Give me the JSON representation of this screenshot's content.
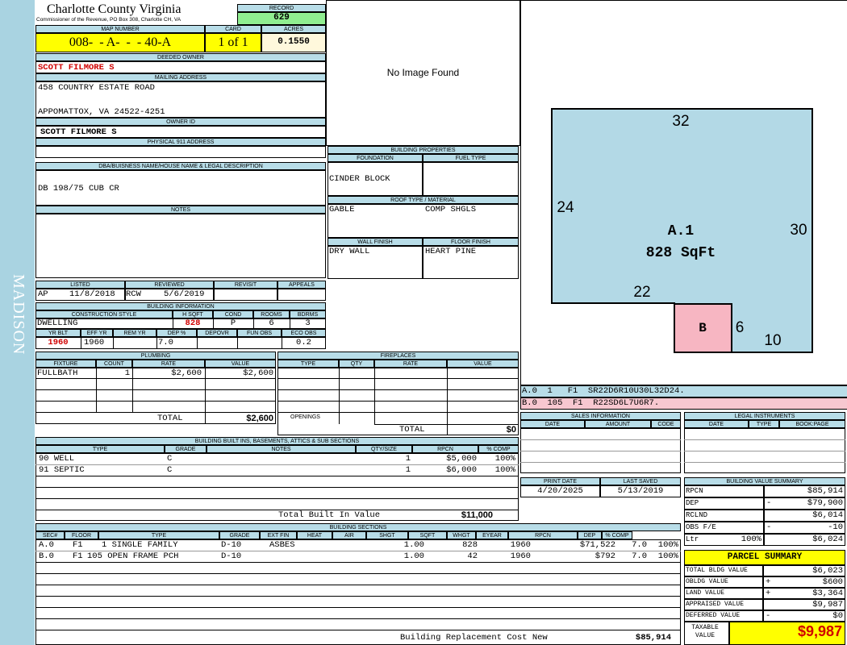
{
  "sidebar": {
    "label": "MADISON"
  },
  "header": {
    "county": "Charlotte County Virginia",
    "office": "Commissioner of the Revenue, PO Box 308, Charlotte CH, VA",
    "record_label": "RECORD",
    "record": "629",
    "map_label": "MAP NUMBER",
    "map_number": "008-  - A-  -  - 40-A",
    "card_label": "CARD",
    "card": "1 of 1",
    "acres_label": "ACRES",
    "acres": "0.1550"
  },
  "owner": {
    "deeded_label": "DEEDED OWNER",
    "deeded": "SCOTT FILMORE S",
    "mailing_label": "MAILING ADDRESS",
    "addr1": "458 COUNTRY ESTATE ROAD",
    "addr2": "APPOMATTOX, VA 24522-4251",
    "id_label": "OWNER ID",
    "id_value": "SCOTT FILMORE S",
    "phys_label": "PHYSICAL 911 ADDRESS",
    "phys_value": ""
  },
  "legal": {
    "label": "DBA/BUISNESS NAME/HOUSE NAME & LEGAL DESCRIPTION",
    "value": "DB 198/75 CUB CR"
  },
  "notes": {
    "label": "NOTES"
  },
  "image": {
    "text": "No Image Found"
  },
  "building_props": {
    "title": "BUILDING PROPERTIES",
    "foundation_label": "FOUNDATION",
    "foundation": "CINDER BLOCK",
    "fuel_label": "FUEL TYPE",
    "fuel": "",
    "roof_label": "ROOF TYPE / MATERIAL",
    "roof_type": "GABLE",
    "roof_mat": "COMP SHGLS",
    "wall_label": "WALL FINISH",
    "wall": "DRY WALL",
    "floor_label": "FLOOR FINISH",
    "floor": "HEART PINE"
  },
  "review": {
    "listed_label": "LISTED",
    "listed_by": "AP",
    "listed_date": "11/8/2018",
    "reviewed_label": "REVIEWED",
    "reviewed_by": "RCW",
    "reviewed_date": "5/6/2019",
    "revisit_label": "REVISIT",
    "appeals_label": "APPEALS"
  },
  "building_info": {
    "title": "BUILDING INFORMATION",
    "style_label": "CONSTRUCTION STYLE",
    "style": "DWELLING",
    "hsqft_label": "H SQFT",
    "hsqft": "828",
    "cond_label": "COND",
    "cond": "P",
    "rooms_label": "ROOMS",
    "rooms": "6",
    "bdrms_label": "BDRMS",
    "bdrms": "3",
    "yrblt_label": "YR BLT",
    "yrblt": "1960",
    "effyr_label": "EFF YR",
    "effyr": "1960",
    "remyr_label": "REM YR",
    "remyr": "",
    "dep_label": "DEP %",
    "dep": "7.0",
    "depovr_label": "DEPOVR",
    "depovr": "",
    "funobs_label": "FUN OBS",
    "funobs": "",
    "ecoobs_label": "ECO OBS",
    "ecoobs": "0.2"
  },
  "plumbing": {
    "title": "PLUMBING",
    "h_fixture": "FIXTURE",
    "h_count": "COUNT",
    "h_rate": "RATE",
    "h_value": "VALUE",
    "rows": [
      {
        "fixture": "FULLBATH",
        "count": "1",
        "rate": "$2,600",
        "value": "$2,600"
      }
    ],
    "total_label": "TOTAL",
    "total": "$2,600"
  },
  "fireplaces": {
    "title": "FIREPLACES",
    "h_type": "TYPE",
    "h_qty": "QTY",
    "h_rate": "RATE",
    "h_value": "VALUE",
    "openings_label": "OPENINGS",
    "total_label": "TOTAL",
    "total": "$0"
  },
  "builtins": {
    "title": "BUILDING BUILT INS, BASEMENTS, ATTICS & SUB SECTIONS",
    "h_type": "TYPE",
    "h_grade": "GRADE",
    "h_notes": "NOTES",
    "h_qty": "QTY/SIZE",
    "h_rpcn": "RPCN",
    "h_comp": "% COMP",
    "rows": [
      {
        "type": "90 WELL",
        "grade": "C",
        "qty": "1",
        "rpcn": "$5,000",
        "comp": "100%"
      },
      {
        "type": "91 SEPTIC",
        "grade": "C",
        "qty": "1",
        "rpcn": "$6,000",
        "comp": "100%"
      }
    ],
    "total_label": "Total Built In Value",
    "total": "$11,000"
  },
  "sections": {
    "title": "BUILDING SECTIONS",
    "headers": [
      "SEC#",
      "FLOOR",
      "TYPE",
      "GRADE",
      "EXT FIN",
      "HEAT",
      "AIR",
      "SHGT",
      "SQFT",
      "WHGT",
      "EYEAR",
      "RPCN",
      "DEP",
      "% COMP"
    ],
    "rows": [
      {
        "sec": "A.0",
        "floor": "F1",
        "type": "1 SINGLE FAMILY",
        "grade": "D-10",
        "ext": "ASBES",
        "shgt": "1.00",
        "sqft": "828",
        "eyear": "1960",
        "rpcn": "$71,522",
        "dep": "7.0",
        "comp": "100%"
      },
      {
        "sec": "B.0",
        "floor": "F1",
        "type": "105 OPEN FRAME PCH",
        "grade": "D-10",
        "ext": "",
        "shgt": "1.00",
        "sqft": "42",
        "eyear": "1960",
        "rpcn": "$792",
        "dep": "7.0",
        "comp": "100%"
      }
    ],
    "brcn_label": "Building Replacement Cost New",
    "brcn": "$85,914"
  },
  "sketch": {
    "a_label": "A.1",
    "a_area": "828 SqFt",
    "b_label": "B",
    "dims": [
      "32",
      "24",
      "30",
      "22",
      "6",
      "10"
    ],
    "colors": {
      "a": "#b3d9e6",
      "b": "#f7b6c2"
    }
  },
  "sketch_codes": [
    {
      "code": "A.0  1   F1  SR22D6R10U30L32D24."
    },
    {
      "code": "B.0  105  F1  R22SD6L7U6R7."
    }
  ],
  "sales": {
    "title": "SALES INFORMATION",
    "h_date": "DATE",
    "h_amount": "AMOUNT",
    "h_code": "CODE"
  },
  "legal_inst": {
    "title": "LEGAL INSTRUMENTS",
    "h_date": "DATE",
    "h_type": "TYPE",
    "h_book": "BOOK:PAGE"
  },
  "dates": {
    "print_label": "PRINT DATE",
    "print_date": "4/20/2025",
    "saved_label": "LAST SAVED",
    "saved_date": "5/13/2019"
  },
  "bvs": {
    "title": "BUILDING VALUE SUMMARY",
    "rows": [
      {
        "label": "RPCN",
        "sign": "",
        "pct": "",
        "value": "$85,914"
      },
      {
        "label": "DEP",
        "sign": "-",
        "pct": "",
        "value": "$79,900"
      },
      {
        "label": "RCLND",
        "sign": "",
        "pct": "",
        "value": "$6,014"
      },
      {
        "label": "OBS F/E",
        "sign": "-",
        "pct": "",
        "value": "-10"
      },
      {
        "label": "Ltr",
        "sign": "",
        "pct": "100%",
        "value": "$6,024"
      }
    ]
  },
  "parcel": {
    "title": "PARCEL SUMMARY",
    "rows": [
      {
        "label": "TOTAL BLDG VALUE",
        "sign": "",
        "value": "$6,023"
      },
      {
        "label": "OBLDG VALUE",
        "sign": "+",
        "value": "$600"
      },
      {
        "label": "LAND VALUE",
        "sign": "+",
        "value": "$3,364"
      },
      {
        "label": "APPRAISED VALUE",
        "sign": "",
        "value": "$9,987"
      },
      {
        "label": "DEFERRED VALUE",
        "sign": "-",
        "value": "$0"
      }
    ],
    "taxable_label": "TAXABLE VALUE",
    "taxable": "$9,987"
  }
}
